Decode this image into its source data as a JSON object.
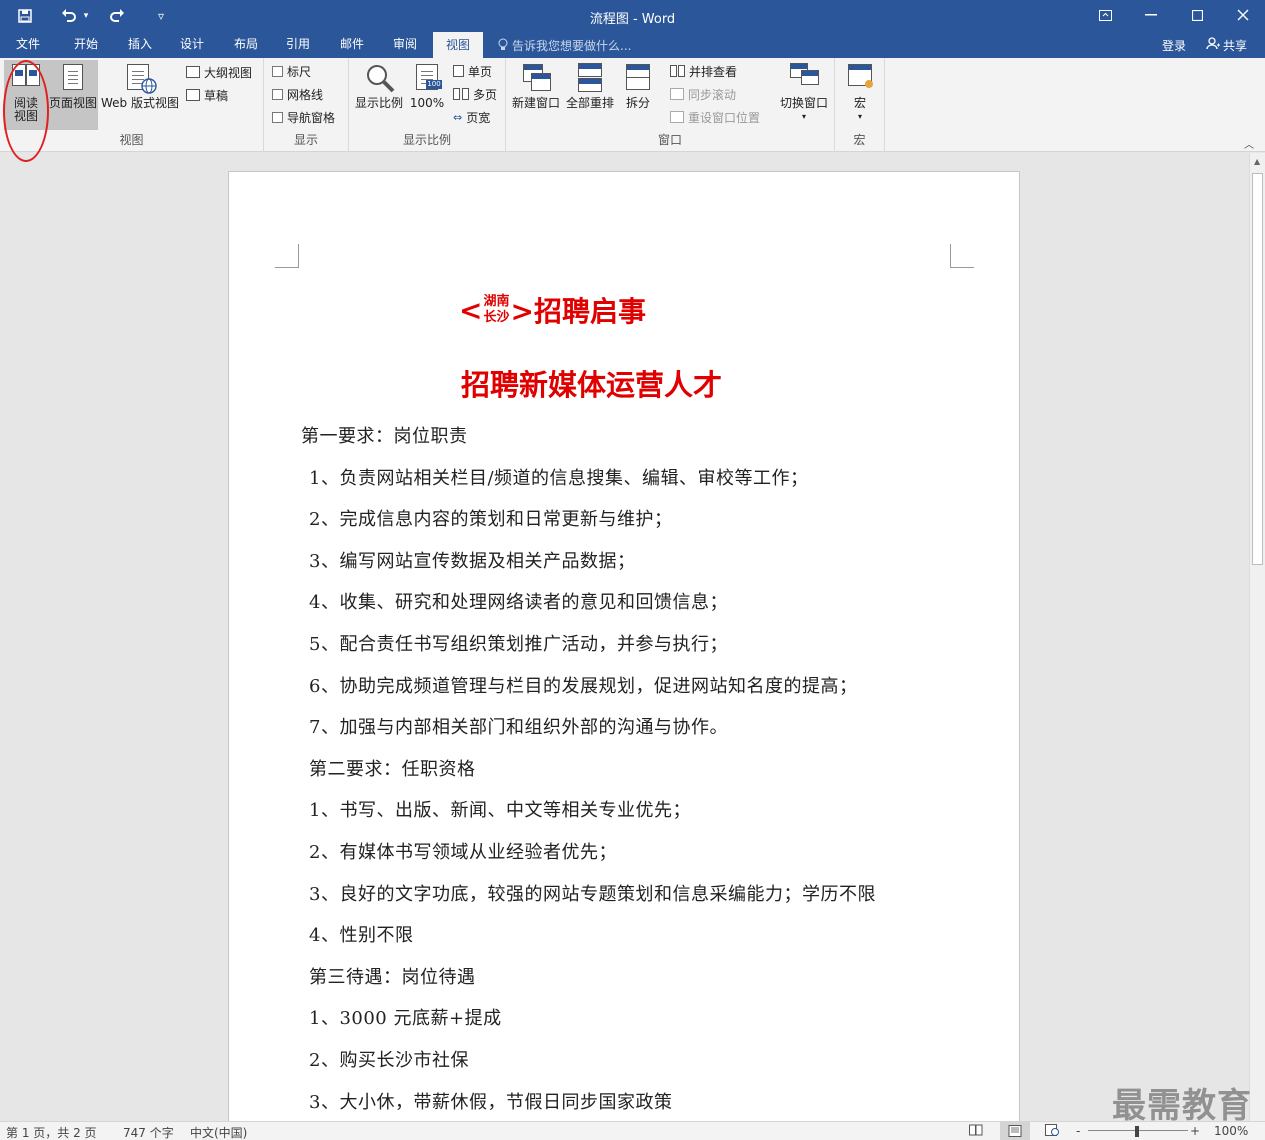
{
  "titlebar": {
    "title": "流程图 - Word",
    "save_icon": "save-icon",
    "undo_icon": "undo-icon",
    "redo_icon": "redo-icon"
  },
  "tabs": {
    "items": [
      "文件",
      "开始",
      "插入",
      "设计",
      "布局",
      "引用",
      "邮件",
      "审阅",
      "视图"
    ],
    "active": "视图",
    "tellme": "告诉我您想要做什么...",
    "login": "登录",
    "share": "共享"
  },
  "ribbon": {
    "views": {
      "read": "阅读视图",
      "read_line1": "阅读",
      "read_line2": "视图",
      "print": "页面视图",
      "web": "Web 版式视图",
      "outline": "大纲视图",
      "draft": "草稿",
      "label": "视图"
    },
    "show": {
      "ruler": "标尺",
      "gridlines": "网格线",
      "navpane": "导航窗格",
      "label": "显示"
    },
    "zoom": {
      "zoom": "显示比例",
      "hundred": "100%",
      "onepage": "单页",
      "multipage": "多页",
      "pagewidth": "页宽",
      "label": "显示比例"
    },
    "window": {
      "newwin": "新建窗口",
      "arrange": "全部重排",
      "split": "拆分",
      "sidebyside": "并排查看",
      "syncscroll": "同步滚动",
      "resetpos": "重设窗口位置",
      "switch": "切换窗口",
      "label": "窗口"
    },
    "macro": {
      "macros": "宏",
      "label": "宏"
    }
  },
  "document": {
    "title_prefix": "<",
    "title_top": "湖南",
    "title_bottom": "长沙",
    "title_suffix": ">招聘启事",
    "subtitle": "招聘新媒体运营人才",
    "lines": [
      "第一要求：岗位职责",
      "1、负责网站相关栏目/频道的信息搜集、编辑、审校等工作；",
      "2、完成信息内容的策划和日常更新与维护；",
      "3、编写网站宣传数据及相关产品数据；",
      "4、收集、研究和处理网络读者的意见和回馈信息；",
      "5、配合责任书写组织策划推广活动，并参与执行；",
      "6、协助完成频道管理与栏目的发展规划，促进网站知名度的提高；",
      "7、加强与内部相关部门和组织外部的沟通与协作。",
      "第二要求：任职资格",
      "1、书写、出版、新闻、中文等相关专业优先；",
      "2、有媒体书写领域从业经验者优先；",
      "3、良好的文字功底，较强的网站专题策划和信息采编能力；学历不限",
      "4、性别不限",
      "第三待遇：岗位待遇",
      "1、3000 元底薪+提成",
      "2、购买长沙市社保",
      "3、大小休，带薪休假，节假日同步国家政策"
    ]
  },
  "statusbar": {
    "page": "第 1 页，共 2 页",
    "words": "747 个字",
    "lang": "中文(中国)",
    "zoom": "100%",
    "zoom_minus": "-",
    "zoom_plus": "+"
  },
  "watermark": "最需教育",
  "colors": {
    "brand": "#2b579a",
    "title_red": "#e00000"
  }
}
